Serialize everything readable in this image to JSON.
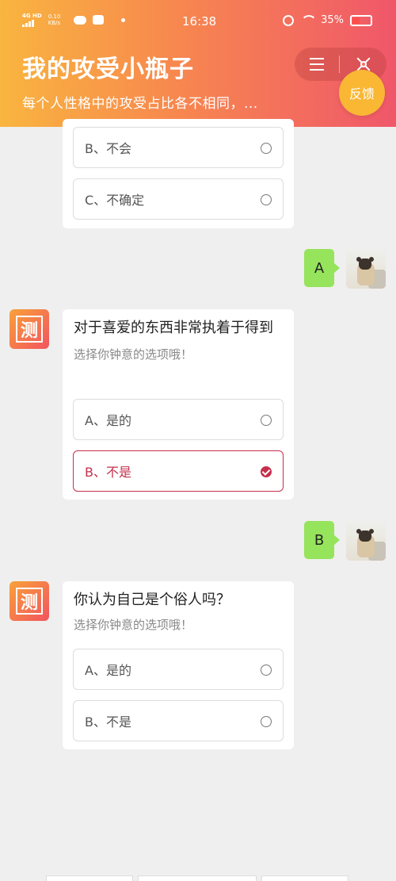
{
  "status_bar": {
    "network": "4G HD",
    "speed": "0.10 KB/s",
    "time": "16:38",
    "battery": "35%"
  },
  "header": {
    "title": "我的攻受小瓶子",
    "subtitle": "每个人性格中的攻受占比各不相同，...",
    "feedback_label": "反馈"
  },
  "bot_icon_char": "测",
  "card0": {
    "options": [
      {
        "label": "B、不会",
        "selected": false
      },
      {
        "label": "C、不确定",
        "selected": false
      }
    ]
  },
  "answer1": "A",
  "card1": {
    "question": "对于喜爱的东西非常执着于得到",
    "hint": "选择你钟意的选项哦！",
    "options": [
      {
        "label": "A、是的",
        "selected": false
      },
      {
        "label": "B、不是",
        "selected": true
      }
    ]
  },
  "answer2": "B",
  "card2": {
    "question": "你认为自己是个俗人吗？",
    "hint": "选择你钟意的选项哦！",
    "options": [
      {
        "label": "A、是的",
        "selected": false
      },
      {
        "label": "B、不是",
        "selected": false
      }
    ]
  },
  "colors": {
    "header_start": "#f9b53f",
    "header_end": "#f0576a",
    "selected": "#c5304c",
    "user_bubble": "#95e45b",
    "feedback_bg": "#f9b734"
  }
}
